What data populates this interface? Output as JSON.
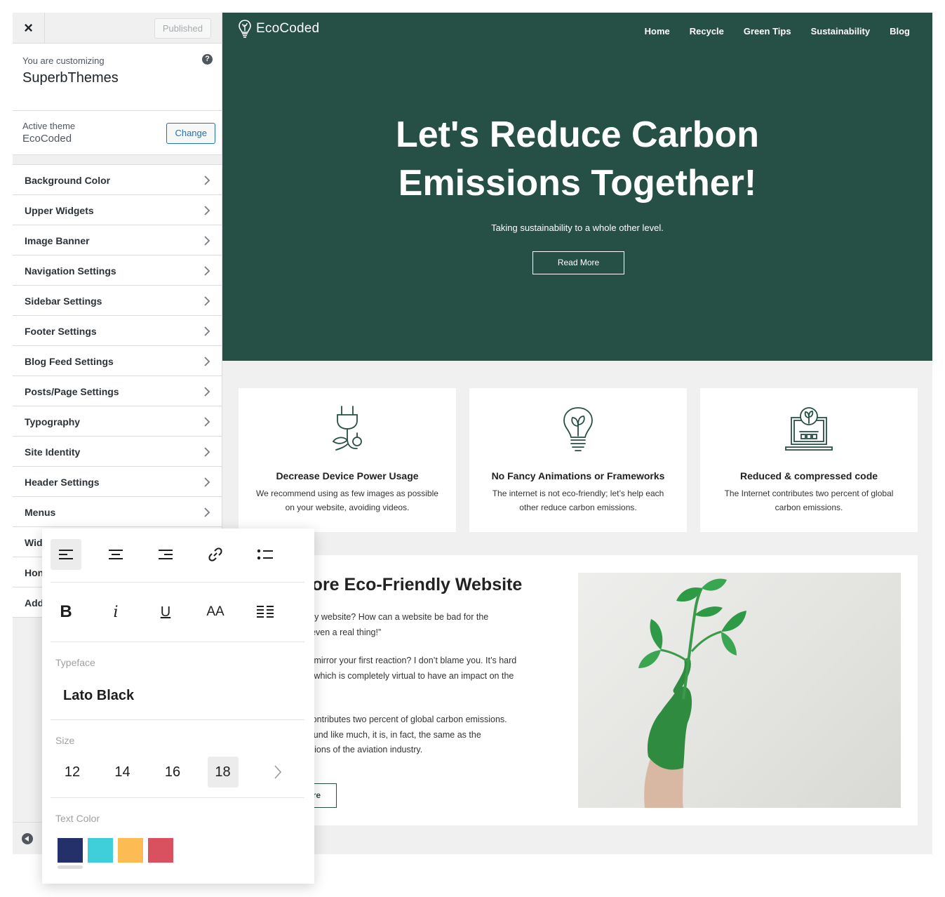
{
  "sidebar": {
    "close_label": "×",
    "published_label": "Published",
    "customizing_label": "You are customizing",
    "site_name": "SuperbThemes",
    "help_label": "?",
    "active_theme_label": "Active theme",
    "active_theme_name": "EcoCoded",
    "change_label": "Change",
    "panels": [
      "Background Color",
      "Upper Widgets",
      "Image Banner",
      "Navigation Settings",
      "Sidebar Settings",
      "Footer Settings",
      "Blog Feed Settings",
      "Posts/Page Settings",
      "Typography",
      "Site Identity",
      "Header Settings",
      "Menus",
      "Wid",
      "Hon",
      "Add"
    ]
  },
  "preview": {
    "logo_text": "EcoCoded",
    "nav": [
      "Home",
      "Recycle",
      "Green Tips",
      "Sustainability",
      "Blog"
    ],
    "hero": {
      "title_line1": "Let's Reduce Carbon",
      "title_line2": "Emissions Together!",
      "subtitle": "Taking sustainability to a whole other level.",
      "button": "Read More"
    },
    "features": [
      {
        "icon": "plug-leaf-icon",
        "title": "Decrease Device Power Usage",
        "line1": "We recommend using as few images as possible",
        "line2": "on your website, avoiding videos."
      },
      {
        "icon": "lightbulb-leaf-icon",
        "title": "No Fancy Animations or Frameworks",
        "line1": "The internet is not eco-friendly; let’s help each",
        "line2": "other reduce carbon emissions."
      },
      {
        "icon": "laptop-plant-icon",
        "title": "Reduced & compressed code",
        "line1": "The Internet contributes two percent of global",
        "line2": "carbon emissions."
      }
    ],
    "article": {
      "title": "a More Eco-Friendly Website",
      "p1_line1": "o-friendly website? How can a website be bad for the",
      "p1_line2": "It’s not even a real thing!”",
      "p2_line1": "e might mirror your first reaction? I don’t blame you. It’s hard",
      "p2_line2": "nething which is completely virtual to have an impact on the",
      "p3_line1": "ternet contributes two percent of global carbon emissions.",
      "p3_line2": "y not sound like much, it is, in fact, the same as the",
      "p3_line3": "is emissions of the aviation industry.",
      "button": "re"
    }
  },
  "popover": {
    "toolbar_row1": [
      "align-left-icon",
      "align-center-icon",
      "align-right-icon",
      "link-icon",
      "bullet-list-icon"
    ],
    "toolbar_row2": [
      "bold-icon",
      "italic-icon",
      "underline-icon",
      "font-size-icon",
      "justify-icon"
    ],
    "bold_glyph": "B",
    "italic_glyph": "i",
    "underline_glyph": "U",
    "case_glyph": "AA",
    "typeface_label": "Typeface",
    "typeface_value": "Lato Black",
    "size_label": "Size",
    "sizes": [
      "12",
      "14",
      "16",
      "18"
    ],
    "selected_size": "18",
    "text_color_label": "Text Color",
    "colors": [
      "#23306a",
      "#3ecfdb",
      "#fdbb53",
      "#d9505f"
    ]
  },
  "colors": {
    "hero_green": "#264f45",
    "wp_blue": "#2271b1"
  }
}
